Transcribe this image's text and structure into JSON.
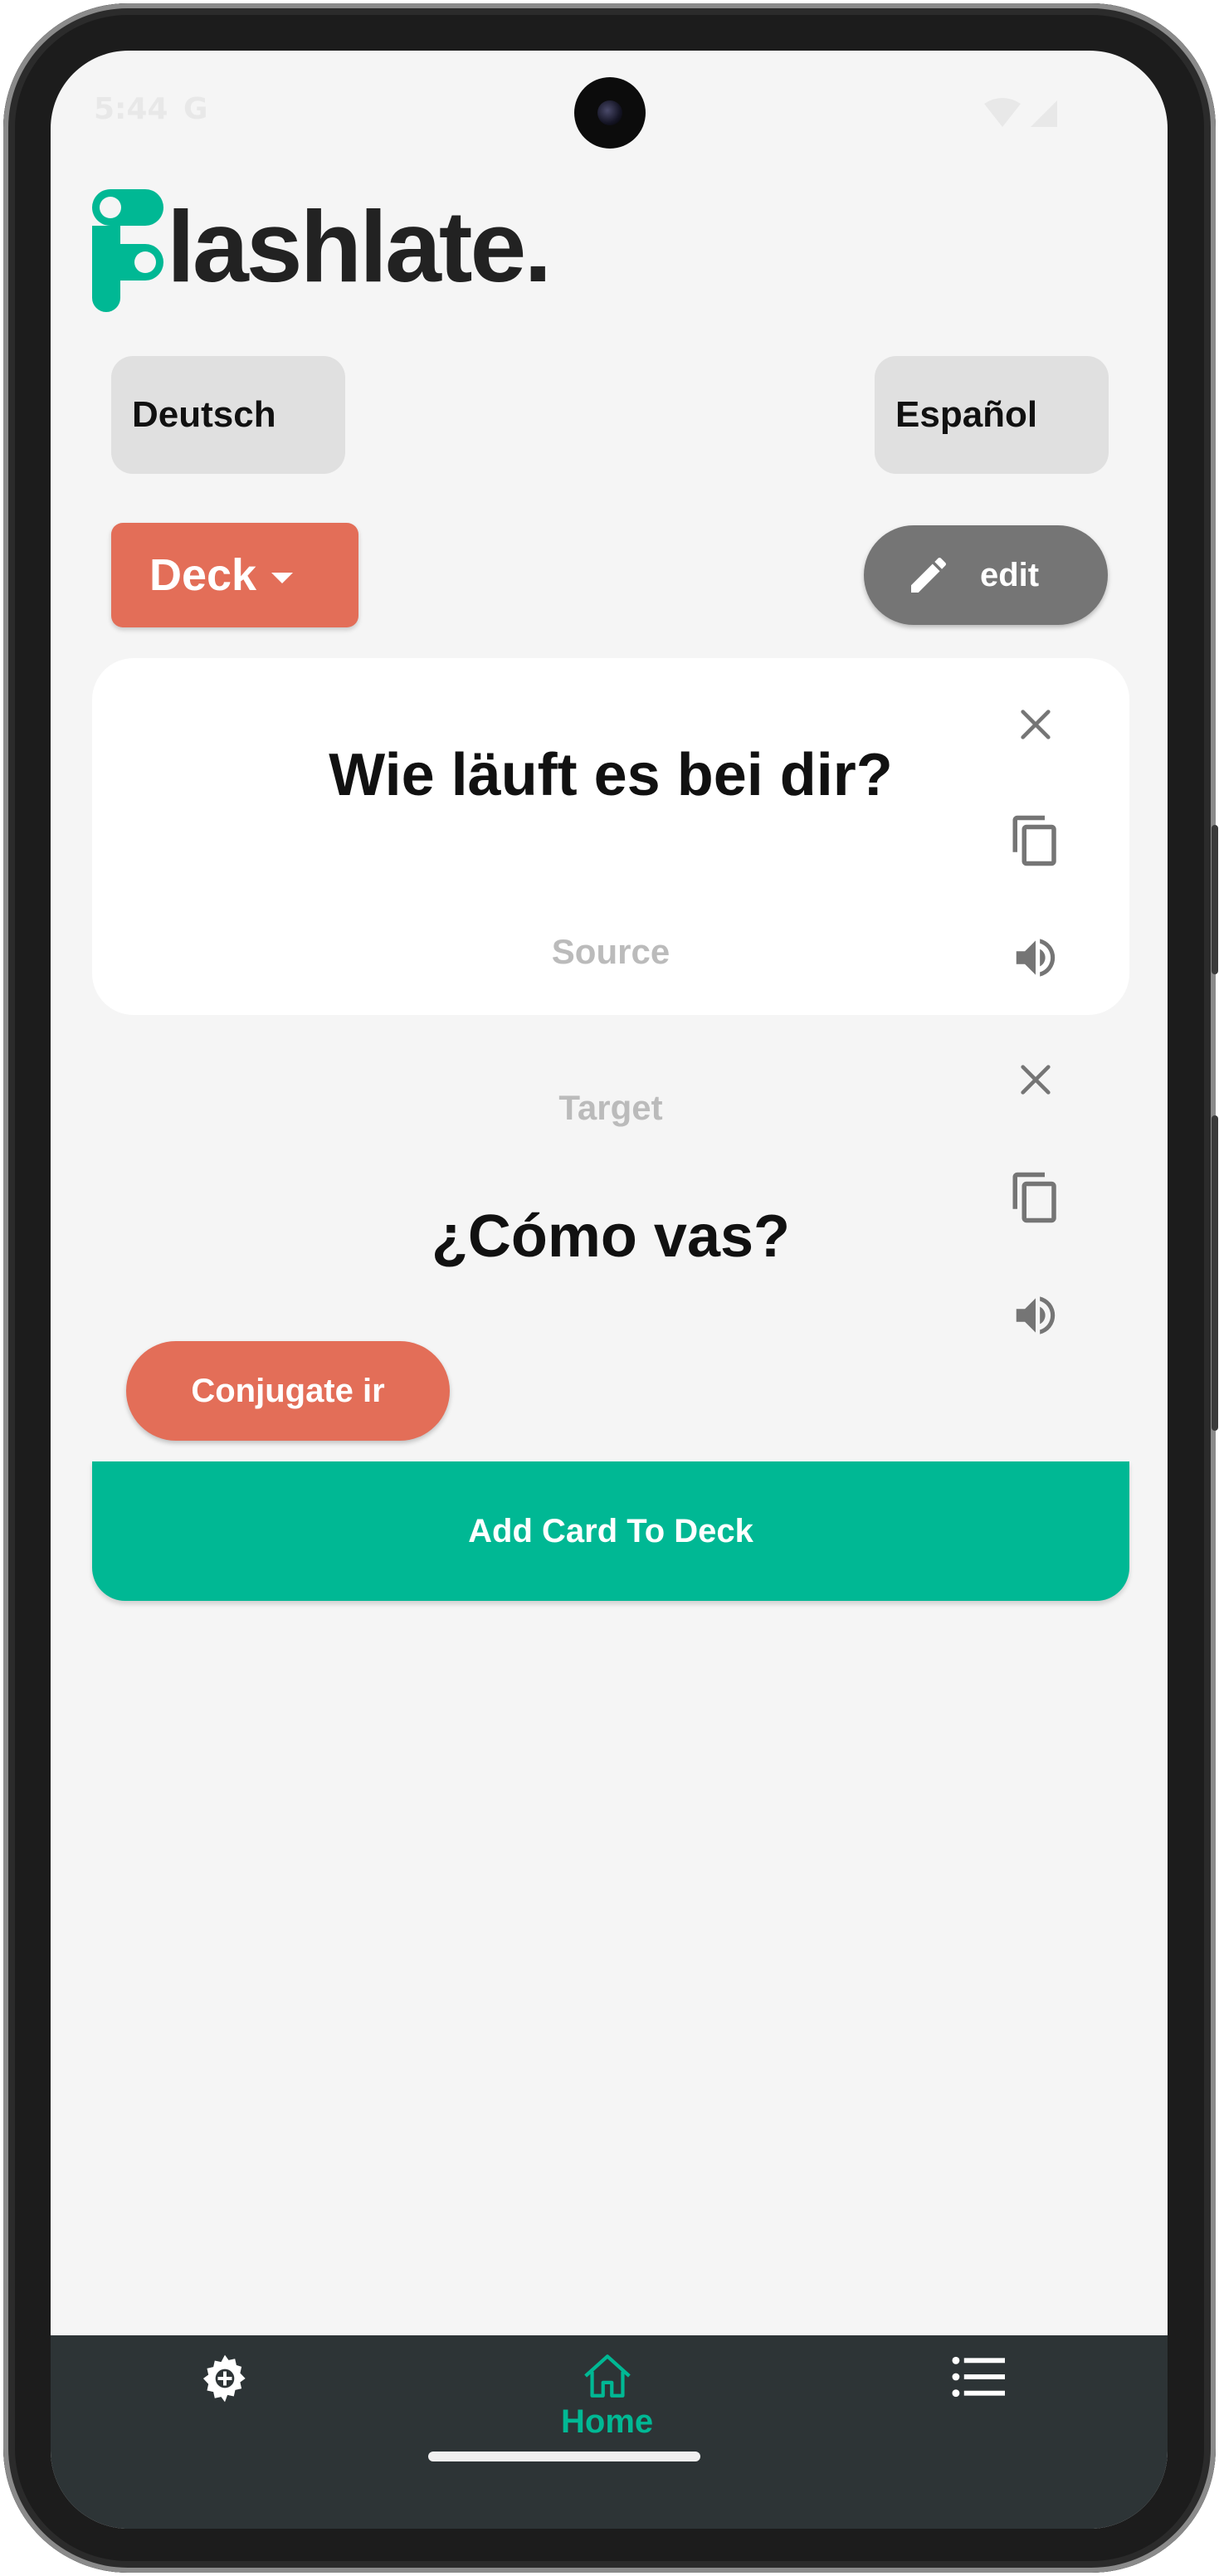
{
  "status_bar": {
    "time": "5:44",
    "google_glyph": "G"
  },
  "app": {
    "logo_text": "lashlate."
  },
  "languages": {
    "source": "Deutsch",
    "target": "Español"
  },
  "toolbar": {
    "deck_label": "Deck",
    "edit_label": "edit"
  },
  "source_card": {
    "phrase": "Wie läuft es bei dir?",
    "hint": "Source"
  },
  "target_card": {
    "hint": "Target",
    "phrase": "¿Cómo vas?"
  },
  "actions": {
    "conjugate_label": "Conjugate ir",
    "add_card_label": "Add Card To Deck"
  },
  "bottom_nav": {
    "items": [
      {
        "icon": "settings-icon",
        "label": ""
      },
      {
        "icon": "home-icon",
        "label": "Home"
      },
      {
        "icon": "list-icon",
        "label": ""
      }
    ]
  },
  "colors": {
    "accent_green": "#00b894",
    "accent_coral": "#e36e58",
    "nav_bg": "#2d3436"
  }
}
